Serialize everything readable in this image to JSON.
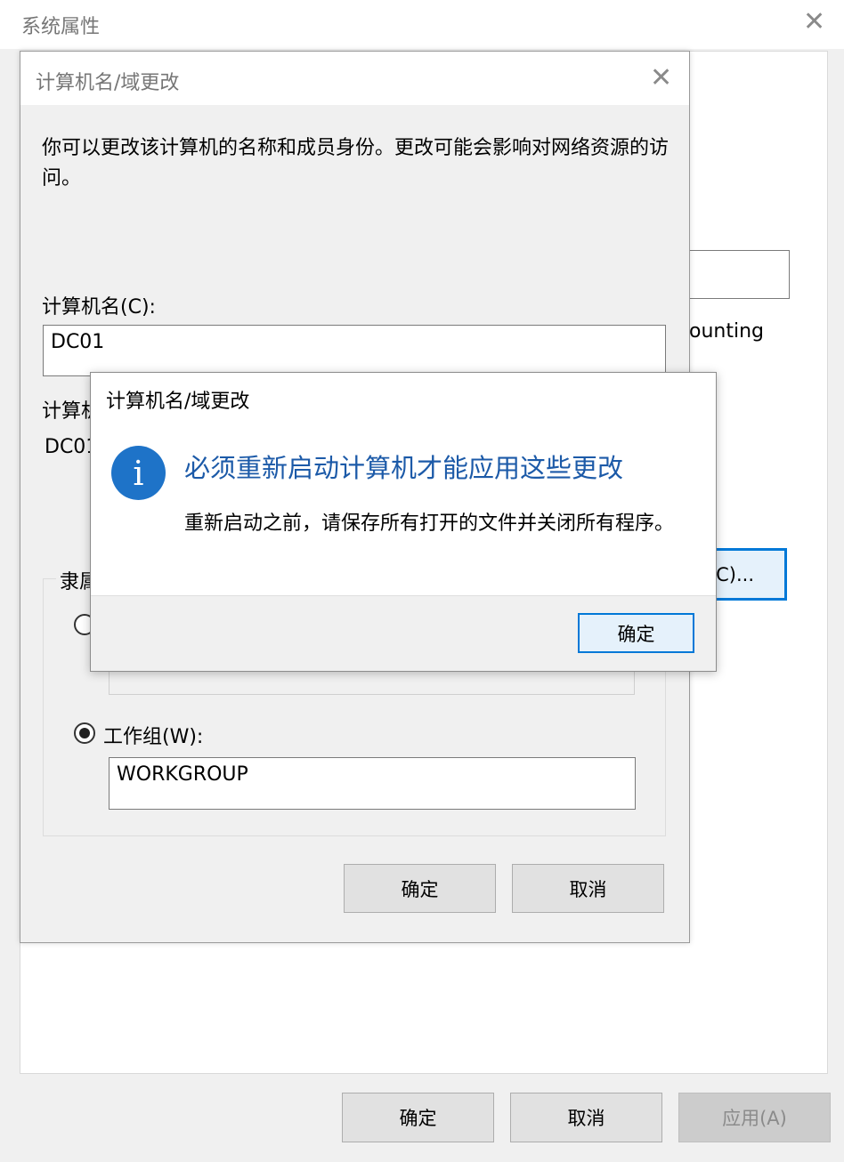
{
  "outer": {
    "title": "系统属性",
    "partial_text_1": "ounting",
    "partial_button_label": "C)...",
    "ok_label": "确定",
    "cancel_label": "取消",
    "apply_label": "应用(A)"
  },
  "change_dialog": {
    "title": "计算机名/域更改",
    "description": "你可以更改该计算机的名称和成员身份。更改可能会影响对网络资源的访问。",
    "computer_name_label": "计算机名(C):",
    "computer_name_value": "DC01",
    "full_name_label_partial": "计算机",
    "full_name_value_partial": "DC01",
    "member_of_label_partial": "隶属",
    "workgroup_label": "工作组(W):",
    "workgroup_value": "WORKGROUP",
    "ok_label": "确定",
    "cancel_label": "取消"
  },
  "message_box": {
    "title": "计算机名/域更改",
    "icon": "info-icon",
    "icon_color": "#1e73c8",
    "heading": "必须重新启动计算机才能应用这些更改",
    "heading_color": "#1c5aa8",
    "body": "重新启动之前，请保存所有打开的文件并关闭所有程序。",
    "ok_label": "确定"
  }
}
